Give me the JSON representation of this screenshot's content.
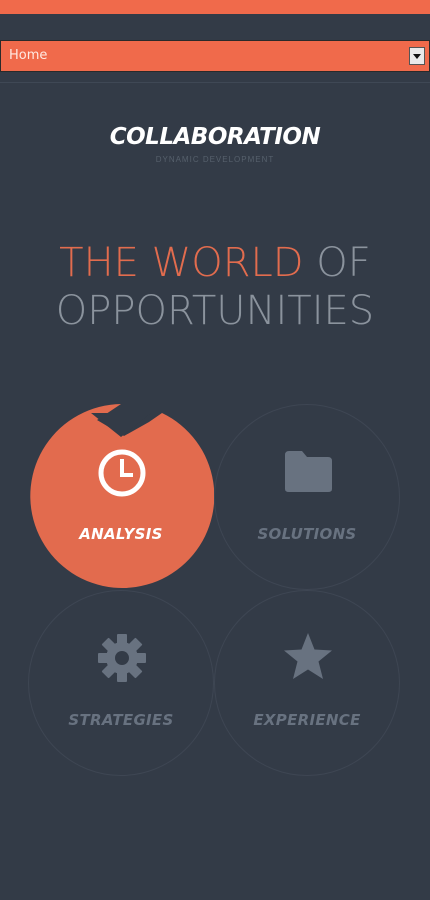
{
  "nav": {
    "selected": "Home"
  },
  "logo": {
    "title": "COLLABORATION",
    "tagline": "DYNAMIC DEVELOPMENT"
  },
  "hero": {
    "line1_accent": "THE WORLD",
    "line1_rest": " OF",
    "line2": "OPPORTUNITIES"
  },
  "tiles": [
    {
      "label": "ANALYSIS",
      "icon": "clock-icon",
      "active": true
    },
    {
      "label": "SOLUTIONS",
      "icon": "folder-icon",
      "active": false
    },
    {
      "label": "STRATEGIES",
      "icon": "gear-icon",
      "active": false
    },
    {
      "label": "EXPERIENCE",
      "icon": "star-icon",
      "active": false
    }
  ],
  "colors": {
    "background": "#333b47",
    "accent": "#f06a4b",
    "tile_active": "#e26b4e",
    "icon_muted": "#687280"
  }
}
